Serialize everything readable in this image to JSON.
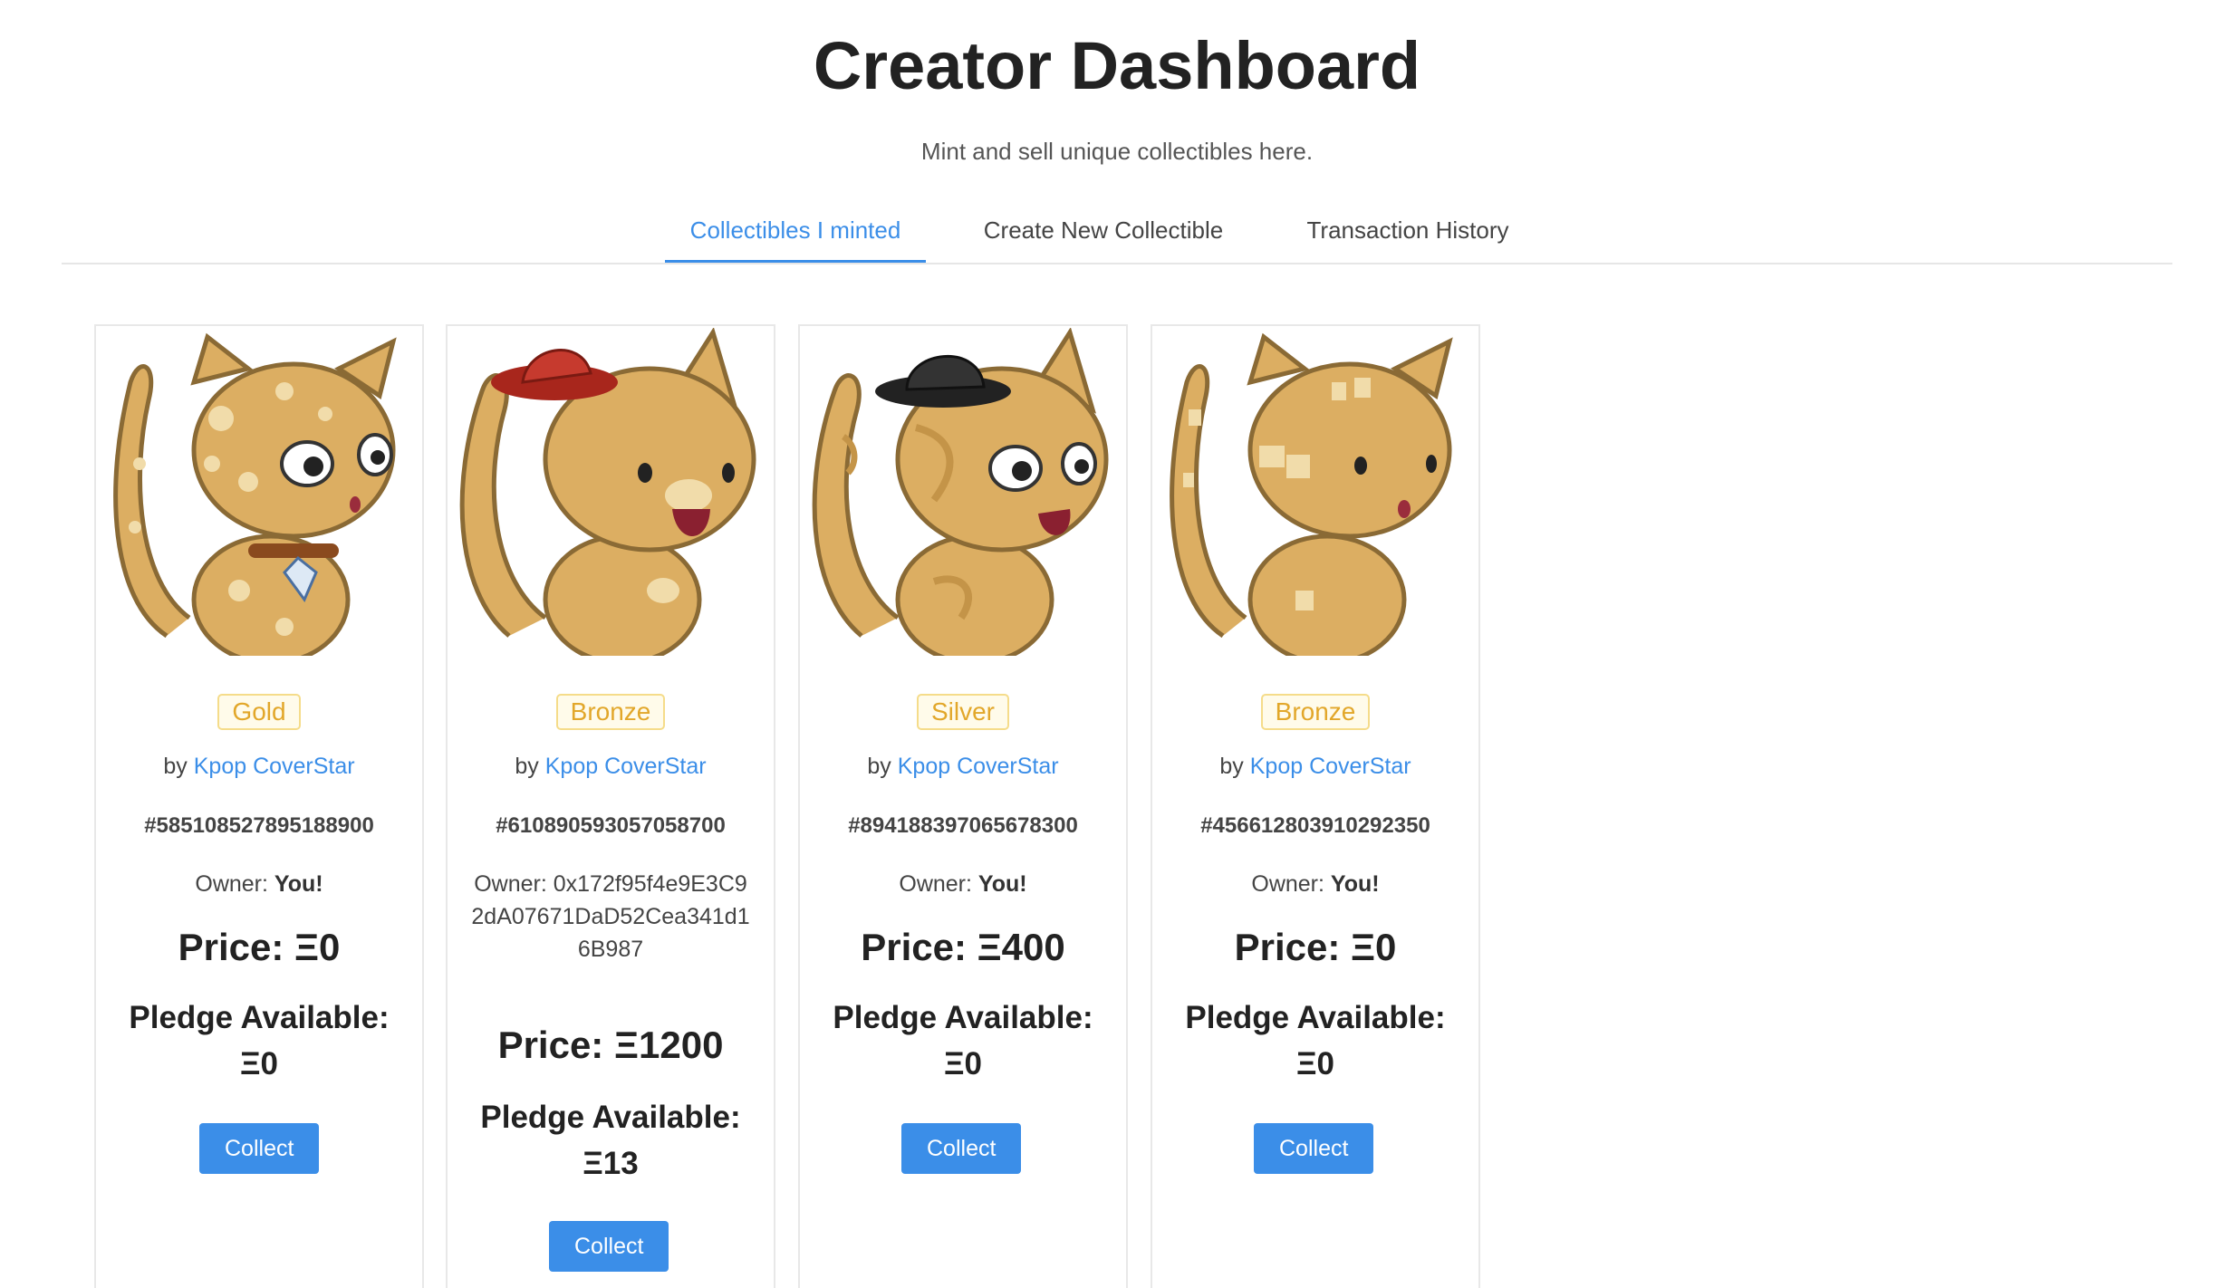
{
  "header": {
    "title": "Creator Dashboard",
    "subtitle": "Mint and sell unique collectibles here."
  },
  "tabs": [
    {
      "label": "Collectibles I minted",
      "active": true
    },
    {
      "label": "Create New Collectible",
      "active": false
    },
    {
      "label": "Transaction History",
      "active": false
    }
  ],
  "colors": {
    "accent": "#3b8ee8",
    "tier_text": "#e2a72a",
    "cat_fur": "#dcae62"
  },
  "cards": [
    {
      "image": "cat-spotted-with-gem-collar",
      "tier": "Gold",
      "by_prefix": "by",
      "creator": "Kpop CoverStar",
      "token_id": "#585108527895188900",
      "owner_label": "Owner:",
      "owner_value": "You!",
      "price": "Price: Ξ0",
      "pledge": "Pledge Available: Ξ0",
      "button": "Collect"
    },
    {
      "image": "cat-with-red-hat",
      "tier": "Bronze",
      "by_prefix": "by",
      "creator": "Kpop CoverStar",
      "token_id": "#610890593057058700",
      "owner_label": "Owner:",
      "owner_value": "0x172f95f4e9E3C92dA07671DaD52Cea341d16B987",
      "price": "Price: Ξ1200",
      "pledge": "Pledge Available: Ξ13",
      "button": "Collect"
    },
    {
      "image": "cat-striped-with-black-hat",
      "tier": "Silver",
      "by_prefix": "by",
      "creator": "Kpop CoverStar",
      "token_id": "#894188397065678300",
      "owner_label": "Owner:",
      "owner_value": "You!",
      "price": "Price: Ξ400",
      "pledge": "Pledge Available: Ξ0",
      "button": "Collect"
    },
    {
      "image": "cat-with-square-spots",
      "tier": "Bronze",
      "by_prefix": "by",
      "creator": "Kpop CoverStar",
      "token_id": "#456612803910292350",
      "owner_label": "Owner:",
      "owner_value": "You!",
      "price": "Price: Ξ0",
      "pledge": "Pledge Available: Ξ0",
      "button": "Collect"
    }
  ]
}
